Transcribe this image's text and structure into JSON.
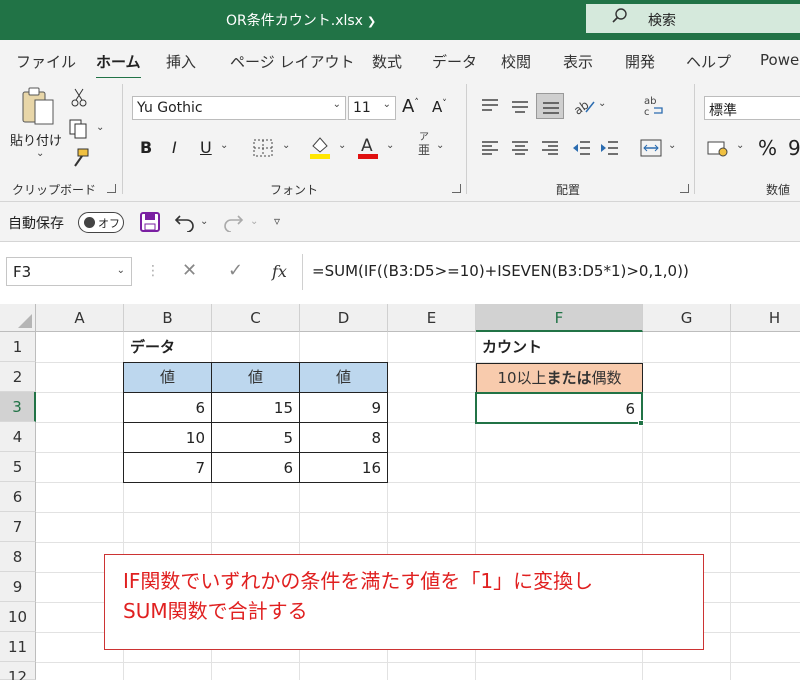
{
  "titlebar": {
    "filename": "OR条件カウント.xlsx",
    "search_label": "検索"
  },
  "tabs": [
    "ファイル",
    "ホーム",
    "挿入",
    "ページ レイアウト",
    "数式",
    "データ",
    "校閲",
    "表示",
    "開発",
    "ヘルプ",
    "Powe"
  ],
  "active_tab": "ホーム",
  "ribbon": {
    "paste_label": "貼り付け",
    "clipboard_label": "クリップボード",
    "font_name": "Yu Gothic",
    "font_size": "11",
    "font_group_label": "フォント",
    "bold": "B",
    "italic": "I",
    "underline": "U",
    "phonetic_top": "ア",
    "phonetic_bottom": "亜",
    "align_group_label": "配置",
    "number_format": "標準",
    "number_group_label": "数値"
  },
  "qat": {
    "autosave_label": "自動保存",
    "toggle_state": "オフ"
  },
  "formula_bar": {
    "name_box": "F3",
    "fx": "fx",
    "formula": "=SUM(IF((B3:D5>=10)+ISEVEN(B3:D5*1)>0,1,0))"
  },
  "columns": [
    "A",
    "B",
    "C",
    "D",
    "E",
    "F",
    "G",
    "H"
  ],
  "rows": [
    "1",
    "2",
    "3",
    "4",
    "5",
    "6",
    "7",
    "8",
    "9",
    "10",
    "11",
    "12"
  ],
  "sheet": {
    "data_title": "データ",
    "value_headers": [
      "値",
      "値",
      "値"
    ],
    "values": [
      [
        "6",
        "15",
        "9"
      ],
      [
        "10",
        "5",
        "8"
      ],
      [
        "7",
        "6",
        "16"
      ]
    ],
    "count_title": "カウント",
    "count_header_pre": "10以上",
    "count_header_bold": "または",
    "count_header_post": "偶数",
    "count_result": "6"
  },
  "callout": {
    "line1": "IF関数でいずれかの条件を満たす値を「1」に変換し",
    "line2": "SUM関数で合計する"
  },
  "colors": {
    "accent": "#217346",
    "blue_header": "#bdd7ee",
    "orange_header": "#f8cbad",
    "callout_red": "#e02020"
  }
}
